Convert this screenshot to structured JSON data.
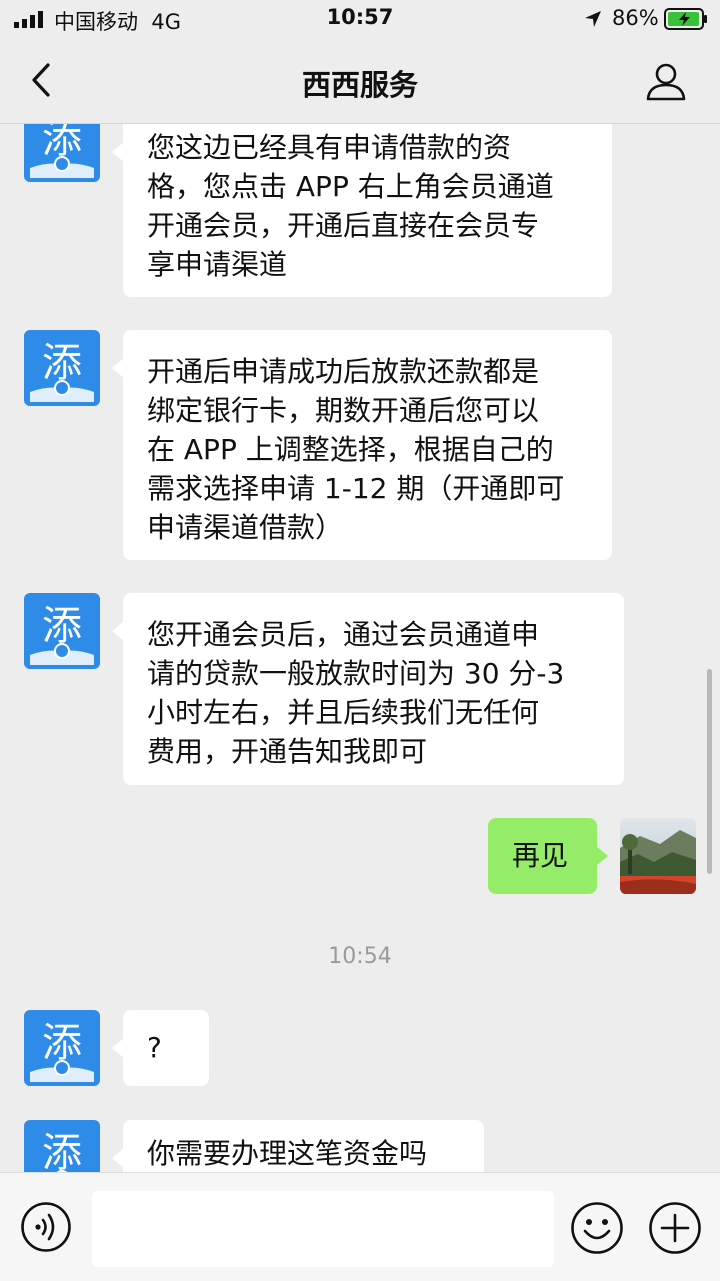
{
  "status_bar": {
    "carrier": "中国移动",
    "network": "4G",
    "time": "10:57",
    "battery_percent": "86%"
  },
  "header": {
    "title": "西西服务"
  },
  "avatar_glyph": "添",
  "messages": [
    {
      "side": "left",
      "text": "您这边已经具有申请借款的资\n格，您点击 APP 右上角会员通道\n开通会员，开通后直接在会员专\n享申请渠道"
    },
    {
      "side": "left",
      "text": "开通后申请成功后放款还款都是\n绑定银行卡，期数开通后您可以\n在 APP 上调整选择，根据自己的\n需求选择申请 1-12 期（开通即可\n申请渠道借款）"
    },
    {
      "side": "left",
      "text": "您开通会员后，通过会员通道申\n请的贷款一般放款时间为 30 分-3\n小时左右，并且后续我们无任何\n费用，开通告知我即可"
    },
    {
      "side": "right",
      "text": "再见"
    },
    {
      "side": "left",
      "text": "?"
    },
    {
      "side": "left",
      "text": "你需要办理这笔资金吗"
    }
  ],
  "timestamp": "10:54",
  "input": {
    "placeholder": ""
  },
  "colors": {
    "background": "#ededed",
    "bubble_right": "#95ec69",
    "avatar_blue": "#2f8be8"
  },
  "icons": [
    "back-icon",
    "person-icon",
    "voice-icon",
    "emoji-icon",
    "plus-icon"
  ]
}
